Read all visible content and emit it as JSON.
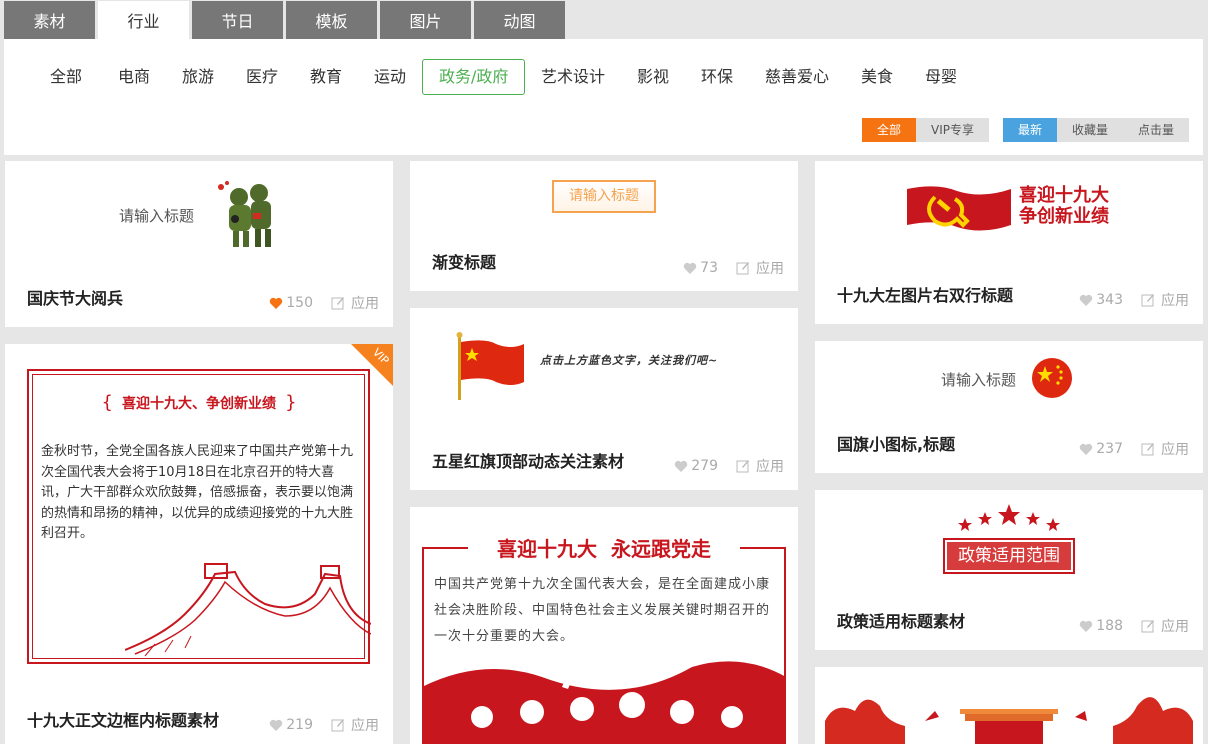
{
  "tabs": [
    "素材",
    "行业",
    "节日",
    "模板",
    "图片",
    "动图"
  ],
  "active_tab": 1,
  "categories": [
    "全部",
    "电商",
    "旅游",
    "医疗",
    "教育",
    "运动",
    "政务/政府",
    "艺术设计",
    "影视",
    "环保",
    "慈善爱心",
    "美食",
    "母婴"
  ],
  "active_category": 6,
  "filters": {
    "scope": [
      "全部",
      "VIP专享"
    ],
    "sort": [
      "最新",
      "收藏量",
      "点击量"
    ]
  },
  "apply_label": "应用",
  "cards": {
    "c1": {
      "title": "国庆节大阅兵",
      "likes": "150",
      "placeholder": "请输入标题"
    },
    "c2": {
      "title": "十九大正文边框内标题素材",
      "likes": "219",
      "vip": "VIP",
      "heading": "喜迎十九大、争创新业绩",
      "body": "金秋时节，全党全国各族人民迎来了中国共产党第十九次全国代表大会将于10月18日在北京召开的特大喜讯，广大干部群众欢欣鼓舞，倍感振奋，表示要以饱满的热情和昂扬的精神，以优异的成绩迎接党的十九大胜利召开。"
    },
    "c3": {
      "title": "渐变标题",
      "likes": "73",
      "placeholder": "请输入标题"
    },
    "c4": {
      "title": "五星红旗顶部动态关注素材",
      "likes": "279",
      "follow_text": "点击上方蓝色文字，关注我们吧~"
    },
    "c5": {
      "heading": "喜迎十九大  永远跟党走",
      "body": "中国共产党第十九次全国代表大会，是在全面建成小康社会决胜阶段、中国特色社会主义发展关键时期召开的一次十分重要的大会。"
    },
    "c6": {
      "title": "十九大左图片右双行标题",
      "likes": "343",
      "line1": "喜迎十九大",
      "line2": "争创新业绩"
    },
    "c7": {
      "title": "国旗小图标,标题",
      "likes": "237",
      "placeholder": "请输入标题"
    },
    "c8": {
      "title": "政策适用标题素材",
      "likes": "188",
      "banner": "政策适用范围"
    }
  },
  "colors": {
    "orange": "#f57310",
    "blue": "#4aa3df",
    "green": "#4caf50",
    "party_red": "#c8161e"
  }
}
